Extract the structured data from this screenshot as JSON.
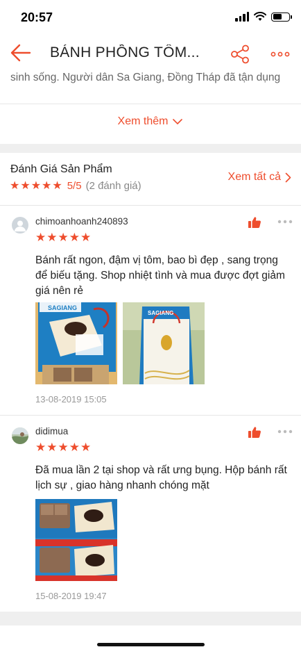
{
  "status_bar": {
    "time": "20:57"
  },
  "nav": {
    "title": "BÁNH PHỒNG TÔM..."
  },
  "description": {
    "snippet": "sinh sống. Người dân Sa Giang, Đồng Tháp đã tận dụng",
    "see_more_label": "Xem thêm"
  },
  "ratings": {
    "title": "Đánh Giá Sản Phẩm",
    "score": "5/5",
    "count": "(2 đánh giá)",
    "stars": 5,
    "view_all_label": "Xem tất cả"
  },
  "reviews": [
    {
      "username": "chimoanhoanh240893",
      "stars": 5,
      "text": "Bánh rất ngon, đậm vị tôm, bao bì đẹp , sang trọng để biếu tặng. Shop nhiệt tình và mua được đợt giảm giá nên rẻ",
      "date": "13-08-2019 15:05"
    },
    {
      "username": "didimua",
      "stars": 5,
      "text": "Đã mua lần 2 tại shop và rất ưng bụng. Hộp bánh rất lịch sự , giao hàng nhanh chóng mặt",
      "date": "15-08-2019 19:47"
    }
  ],
  "colors": {
    "accent": "#ee4d2d",
    "muted": "#999999",
    "divider": "#efefef"
  }
}
